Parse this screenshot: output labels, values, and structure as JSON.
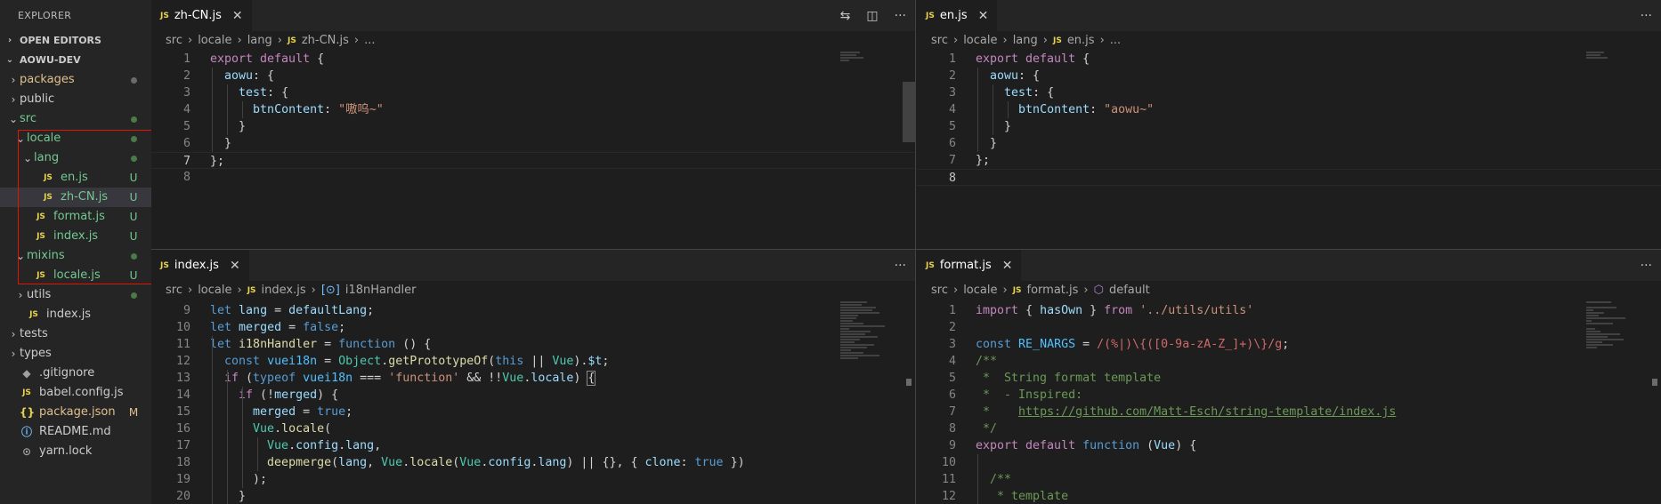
{
  "sidebar": {
    "title": "EXPLORER",
    "open_editors": "OPEN EDITORS",
    "project": "AOWU-DEV",
    "tree": [
      {
        "label": "packages",
        "indent": 1,
        "kind": "folder",
        "open": false,
        "color": "c-yellow",
        "badge": "dot-gray"
      },
      {
        "label": "public",
        "indent": 1,
        "kind": "folder",
        "open": false,
        "color": "c-white",
        "badge": ""
      },
      {
        "label": "src",
        "indent": 1,
        "kind": "folder",
        "open": true,
        "color": "c-green",
        "badge": "dot-green"
      },
      {
        "label": "locale",
        "indent": 2,
        "kind": "folder",
        "open": true,
        "color": "c-green",
        "badge": "dot-green"
      },
      {
        "label": "lang",
        "indent": 3,
        "kind": "folder",
        "open": true,
        "color": "c-green",
        "badge": "dot-green"
      },
      {
        "label": "en.js",
        "indent": 4,
        "kind": "js",
        "color": "c-green",
        "badge": "U"
      },
      {
        "label": "zh-CN.js",
        "indent": 4,
        "kind": "js",
        "color": "c-green",
        "badge": "U",
        "selected": true
      },
      {
        "label": "format.js",
        "indent": 3,
        "kind": "js",
        "color": "c-green",
        "badge": "U"
      },
      {
        "label": "index.js",
        "indent": 3,
        "kind": "js",
        "color": "c-green",
        "badge": "U"
      },
      {
        "label": "mixins",
        "indent": 2,
        "kind": "folder",
        "open": true,
        "color": "c-green",
        "badge": "dot-green"
      },
      {
        "label": "locale.js",
        "indent": 3,
        "kind": "js",
        "color": "c-green",
        "badge": "U"
      },
      {
        "label": "utils",
        "indent": 2,
        "kind": "folder",
        "open": false,
        "color": "c-white",
        "badge": "dot-green"
      },
      {
        "label": "index.js",
        "indent": 2,
        "kind": "js",
        "color": "c-white",
        "badge": ""
      },
      {
        "label": "tests",
        "indent": 1,
        "kind": "folder",
        "open": false,
        "color": "c-white",
        "badge": ""
      },
      {
        "label": "types",
        "indent": 1,
        "kind": "folder",
        "open": false,
        "color": "c-white",
        "badge": ""
      },
      {
        "label": ".gitignore",
        "indent": 1,
        "kind": "git",
        "color": "c-white",
        "badge": ""
      },
      {
        "label": "babel.config.js",
        "indent": 1,
        "kind": "js",
        "color": "c-white",
        "badge": ""
      },
      {
        "label": "package.json",
        "indent": 1,
        "kind": "json",
        "color": "c-yellow",
        "badge": "M"
      },
      {
        "label": "README.md",
        "indent": 1,
        "kind": "info",
        "color": "c-white",
        "badge": ""
      },
      {
        "label": "yarn.lock",
        "indent": 1,
        "kind": "yarn",
        "color": "c-white",
        "badge": ""
      }
    ]
  },
  "editors": {
    "top_left": {
      "tab": "zh-CN.js",
      "breadcrumb": [
        "src",
        "locale",
        "lang",
        "zh-CN.js",
        "..."
      ],
      "lines": [
        "1",
        "2",
        "3",
        "4",
        "5",
        "6",
        "7",
        "8"
      ]
    },
    "top_right": {
      "tab": "en.js",
      "breadcrumb": [
        "src",
        "locale",
        "lang",
        "en.js",
        "..."
      ],
      "lines": [
        "1",
        "2",
        "3",
        "4",
        "5",
        "6",
        "7",
        "8"
      ]
    },
    "bottom_left": {
      "tab": "index.js",
      "breadcrumb": [
        "src",
        "locale",
        "index.js",
        "i18nHandler"
      ],
      "lines": [
        "9",
        "10",
        "11",
        "12",
        "13",
        "14",
        "15",
        "16",
        "17",
        "18",
        "19",
        "20"
      ]
    },
    "bottom_right": {
      "tab": "format.js",
      "breadcrumb": [
        "src",
        "locale",
        "format.js",
        "default"
      ],
      "lines": [
        "1",
        "2",
        "3",
        "4",
        "5",
        "6",
        "7",
        "8",
        "9",
        "10",
        "11",
        "12"
      ]
    }
  },
  "icons": {
    "close": "close-icon",
    "more": "more-actions-icon",
    "split": "split-editor-icon",
    "compare": "compare-changes-icon"
  }
}
